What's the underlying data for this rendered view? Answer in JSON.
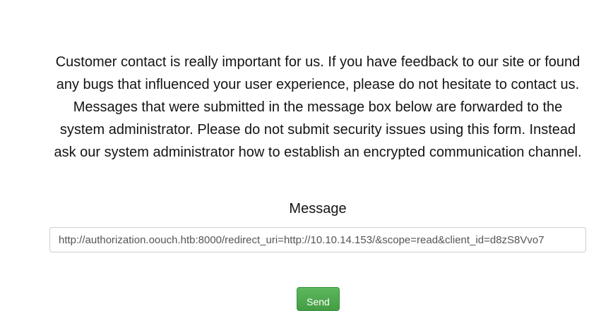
{
  "contact": {
    "intro_text": "Customer contact is really important for us. If you have feedback to our site or found any bugs that influenced your user experience, please do not hesitate to contact us. Messages that were submitted in the message box below are forwarded to the system administrator. Please do not submit security issues using this form. Instead ask our system administrator how to establish an encrypted communication channel.",
    "message_label": "Message",
    "message_value": "http://authorization.oouch.htb:8000/redirect_uri=http://10.10.14.153/&scope=read&client_id=d8zS8Vvo7",
    "send_label": "Send"
  },
  "colors": {
    "send_button": "#5cb85c",
    "input_border": "#cfcfcf"
  }
}
